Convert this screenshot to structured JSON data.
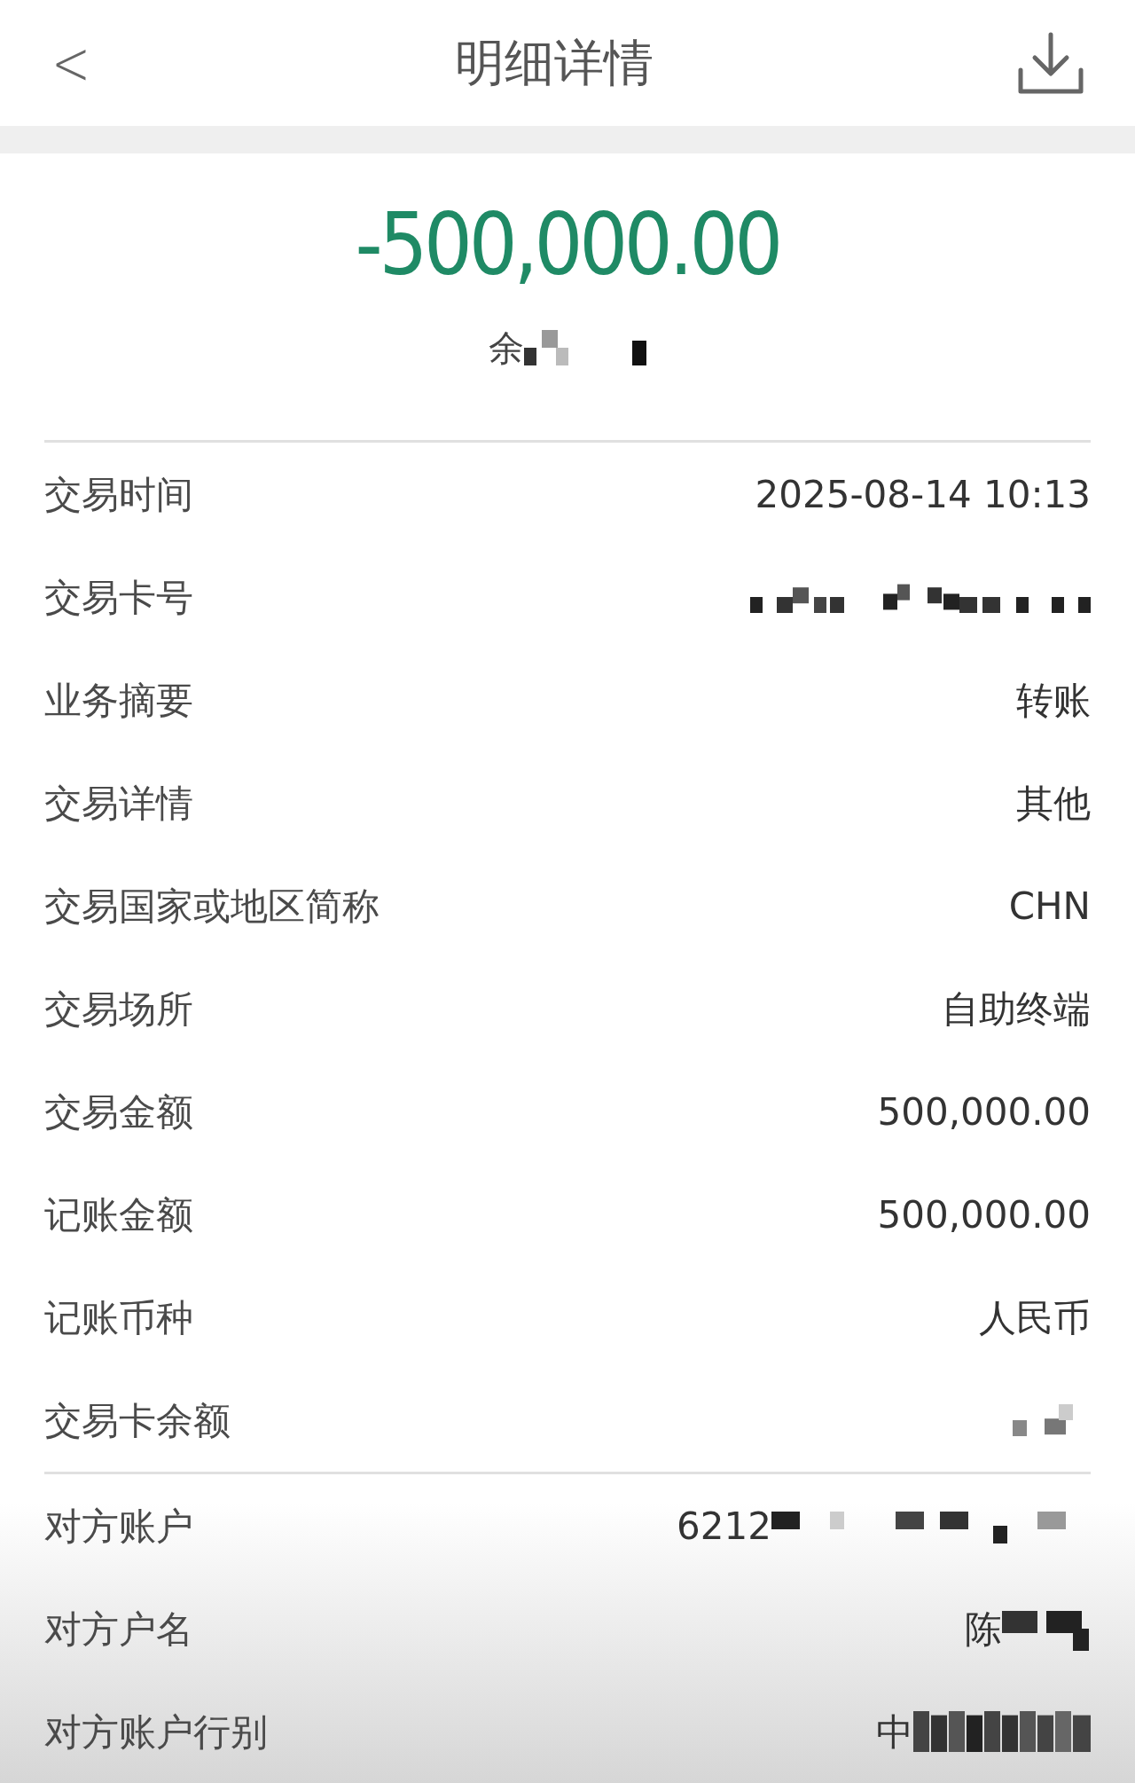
{
  "header": {
    "back": "<",
    "title": "明细详情"
  },
  "summary": {
    "amount": "-500,000.00",
    "balance_label": "余"
  },
  "details": [
    {
      "label": "交易时间",
      "kind": "text",
      "value": "2025-08-14 10:13"
    },
    {
      "label": "交易卡号",
      "kind": "masked"
    },
    {
      "label": "业务摘要",
      "kind": "text",
      "value": "转账"
    },
    {
      "label": "交易详情",
      "kind": "text",
      "value": "其他"
    },
    {
      "label": "交易国家或地区简称",
      "kind": "text",
      "value": "CHN"
    },
    {
      "label": "交易场所",
      "kind": "text",
      "value": "自助终端"
    },
    {
      "label": "交易金额",
      "kind": "text",
      "value": "500,000.00"
    },
    {
      "label": "记账金额",
      "kind": "text",
      "value": "500,000.00"
    },
    {
      "label": "记账币种",
      "kind": "text",
      "value": "人民币"
    },
    {
      "label": "交易卡余额",
      "kind": "masked"
    }
  ],
  "counterparty": [
    {
      "label": "对方账户",
      "kind": "partial",
      "value": "6212"
    },
    {
      "label": "对方户名",
      "kind": "partial",
      "value": "陈"
    },
    {
      "label": "对方账户行别",
      "kind": "partial",
      "value": "中"
    }
  ]
}
